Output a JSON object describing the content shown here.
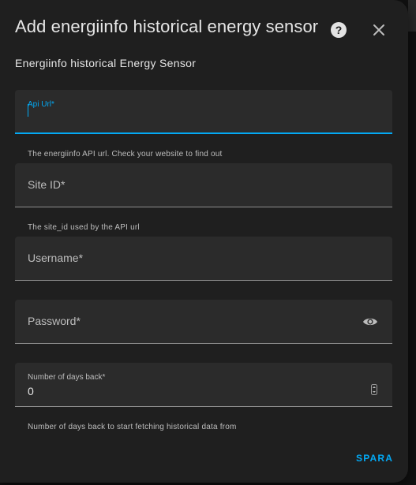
{
  "dialog": {
    "title": "Add energiinfo historical energy sensor",
    "subtitle": "Energiinfo historical Energy Sensor",
    "help_icon": "help-circle-icon",
    "close_icon": "close-icon"
  },
  "fields": {
    "api_url": {
      "label": "Api Url*",
      "value": "",
      "helper": "The energiinfo API url. Check your website to find out",
      "focused": true
    },
    "site_id": {
      "label": "Site ID*",
      "value": "",
      "helper": "The site_id used by the API url"
    },
    "username": {
      "label": "Username*",
      "value": ""
    },
    "password": {
      "label": "Password*",
      "value": "",
      "toggle_icon": "eye-icon"
    },
    "days_back": {
      "label": "Number of days back*",
      "value": "0",
      "helper": "Number of days back to start fetching historical data from",
      "spinner_icon": "number-spinner-icon"
    }
  },
  "actions": {
    "save_label": "SPARA"
  },
  "colors": {
    "accent": "#03a9f4",
    "surface": "#1f1f1f",
    "field_bg": "#2b2b2b",
    "text": "#e6e6e6",
    "muted": "#bdbdbd"
  }
}
